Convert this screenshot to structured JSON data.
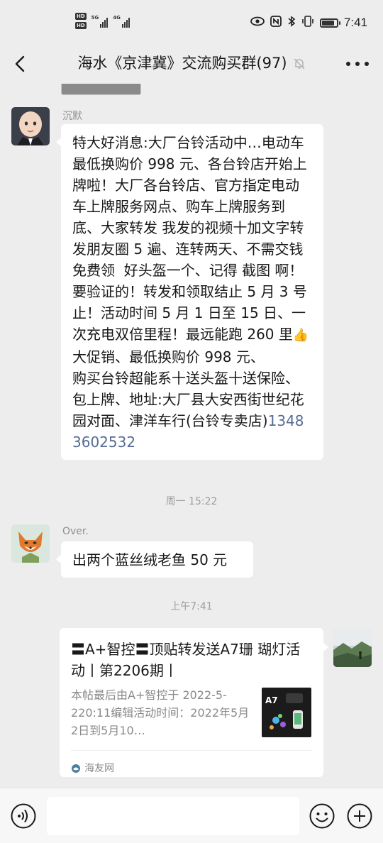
{
  "status_bar": {
    "hd_badges": [
      "HD",
      "HD"
    ],
    "network_labels": [
      "5G",
      "4G"
    ],
    "right_icons": [
      "eye-icon",
      "nfc-icon",
      "bluetooth-icon",
      "vibrate-icon"
    ],
    "battery_level": 0.85,
    "time": "7:41"
  },
  "header": {
    "title": "海水《京津冀》交流购买群(97)",
    "back_icon": "back-arrow-icon",
    "mute_icon": "bell-off-icon",
    "more_icon": "more-icon"
  },
  "messages": [
    {
      "sender": "沉默",
      "avatar": "baby-avatar",
      "text": "特大好消息:大厂台铃活动中…电动车最低换购价 998 元、各台铃店开始上牌啦！大厂各台铃店、官方指定电动车上牌服务网点、购车上牌服务到底、大家转发 我发的视频十加文字转发朋友圈 5 遍、连转两天、不需交钱免费领  好头盔一个、记得 截图 啊！要验证的！转发和领取结止 5 月 3 号止！活动时间 5 月 1 日至 15 日、一次充电双倍里程！最远能跑 260 里",
      "emoji": "👍",
      "text2": "大促销、最低换购价 998 元、\n购买台铃超能系十送头盔十送保险、包上牌、地址:大厂县大安西街世纪花园对面、津洋车行(台铃专卖店)",
      "phone": "13483602532"
    },
    {
      "timestamp": "周一 15:22"
    },
    {
      "sender": "Over.",
      "avatar": "fox-avatar",
      "text": "出两个蓝丝绒老鱼 50 元"
    },
    {
      "timestamp": "上午7:41"
    },
    {
      "avatar": "mountain-avatar",
      "card_title": "〓A+智控〓顶贴转发送A7珊 瑚灯活动丨第2206期丨",
      "card_body": "本帖最后由A+智控于 2022-5-220:11编辑活动时间：2022年5月2日到5月10…",
      "card_thumb_label": "A7",
      "card_source": "海友网"
    }
  ],
  "input_bar": {
    "voice_icon": "voice-icon",
    "emoji_icon": "emoji-icon",
    "plus_icon": "plus-icon",
    "input_value": ""
  }
}
